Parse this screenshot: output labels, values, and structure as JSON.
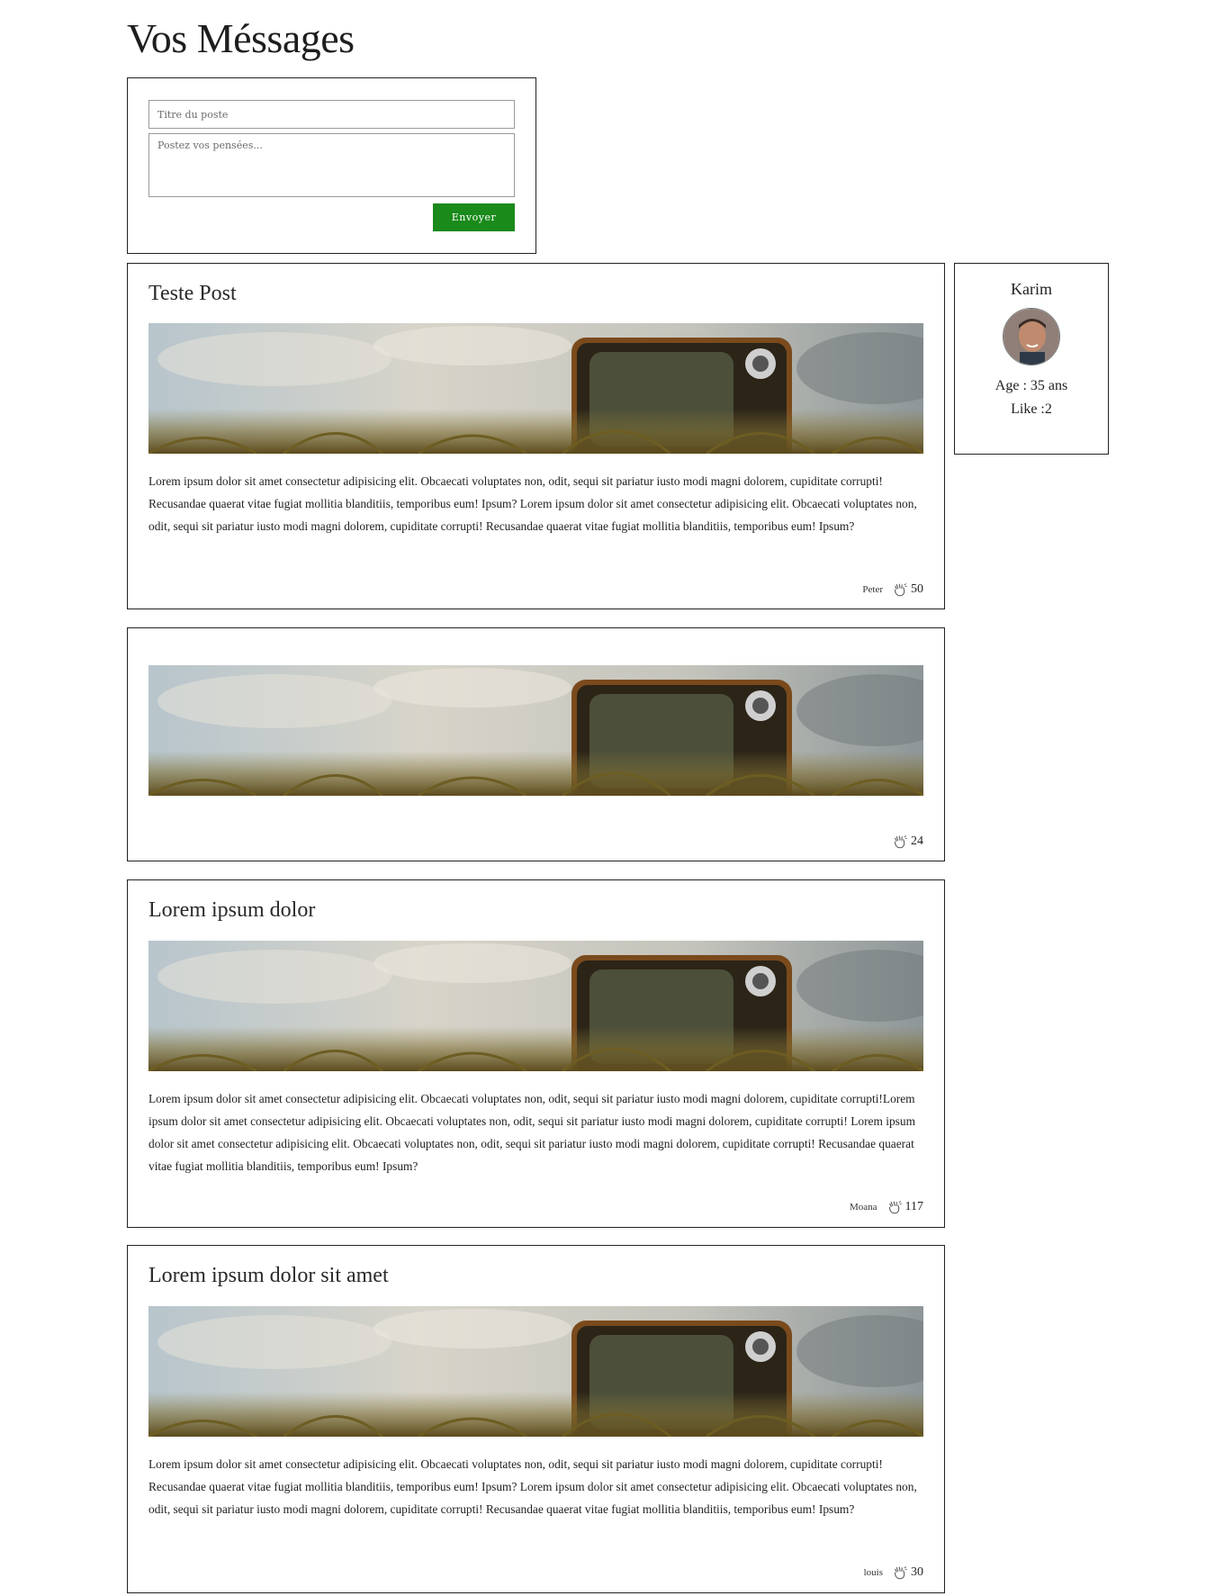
{
  "page": {
    "title": "Vos Méssages"
  },
  "composer": {
    "title_placeholder": "Titre du poste",
    "body_placeholder": "Postez vos pensées...",
    "send_label": "Envoyer",
    "send_color": "#1a8a1a"
  },
  "profile": {
    "name": "Karim",
    "age": "Age : 35 ans",
    "likes": "Like :2"
  },
  "posts": [
    {
      "title": "Teste Post",
      "body": "Lorem ipsum dolor sit amet consectetur adipisicing elit. Obcaecati voluptates non, odit, sequi sit pariatur iusto modi magni dolorem, cupiditate corrupti! Recusandae quaerat vitae fugiat mollitia blanditiis, temporibus eum! Ipsum? Lorem ipsum dolor sit amet consectetur adipisicing elit. Obcaecati voluptates non, odit, sequi sit pariatur iusto modi magni dolorem, cupiditate corrupti! Recusandae quaerat vitae fugiat mollitia blanditiis, temporibus eum! Ipsum?",
      "author": "Peter",
      "likes": "50"
    },
    {
      "title": "",
      "body": "",
      "author": "",
      "likes": "24"
    },
    {
      "title": "Lorem ipsum dolor",
      "body": "Lorem ipsum dolor sit amet consectetur adipisicing elit. Obcaecati voluptates non, odit, sequi sit pariatur iusto modi magni dolorem, cupiditate corrupti!Lorem ipsum dolor sit amet consectetur adipisicing elit. Obcaecati voluptates non, odit, sequi sit pariatur iusto modi magni dolorem, cupiditate corrupti! Lorem ipsum dolor sit amet consectetur adipisicing elit. Obcaecati voluptates non, odit, sequi sit pariatur iusto modi magni dolorem, cupiditate corrupti! Recusandae quaerat vitae fugiat mollitia blanditiis, temporibus eum! Ipsum?",
      "author": "Moana",
      "likes": "117"
    },
    {
      "title": "Lorem ipsum dolor sit amet",
      "body": "Lorem ipsum dolor sit amet consectetur adipisicing elit. Obcaecati voluptates non, odit, sequi sit pariatur iusto modi magni dolorem, cupiditate corrupti! Recusandae quaerat vitae fugiat mollitia blanditiis, temporibus eum! Ipsum? Lorem ipsum dolor sit amet consectetur adipisicing elit. Obcaecati voluptates non, odit, sequi sit pariatur iusto modi magni dolorem, cupiditate corrupti! Recusandae quaerat vitae fugiat mollitia blanditiis, temporibus eum! Ipsum?",
      "author": "louis",
      "likes": "30"
    }
  ]
}
